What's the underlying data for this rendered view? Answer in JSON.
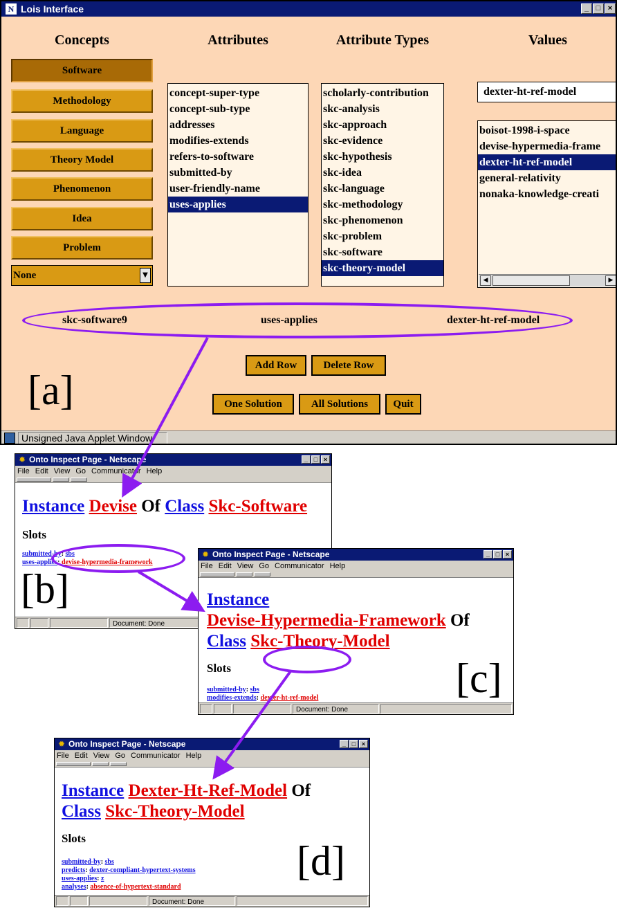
{
  "applet": {
    "title": "Lois Interface",
    "logo": "N",
    "window_buttons": [
      "minimize-icon",
      "maximize-icon",
      "close-icon"
    ],
    "headers": {
      "concepts": "Concepts",
      "attributes": "Attributes",
      "attribute_types": "Attribute Types",
      "values": "Values"
    },
    "concepts": [
      "Software",
      "Methodology",
      "Language",
      "Theory Model",
      "Phenomenon",
      "Idea",
      "Problem"
    ],
    "selected_concept": "Software",
    "dropdown_value": "None",
    "attributes": [
      "concept-super-type",
      "concept-sub-type",
      "addresses",
      "modifies-extends",
      "refers-to-software",
      "submitted-by",
      "user-friendly-name",
      "uses-applies"
    ],
    "selected_attribute": "uses-applies",
    "attribute_types": [
      "scholarly-contribution",
      "skc-analysis",
      "skc-approach",
      "skc-evidence",
      "skc-hypothesis",
      "skc-idea",
      "skc-language",
      "skc-methodology",
      "skc-phenomenon",
      "skc-problem",
      "skc-software",
      "skc-theory-model"
    ],
    "selected_attribute_type": "skc-theory-model",
    "value_input": "dexter-ht-ref-model",
    "values": [
      "boisot-1998-i-space",
      "devise-hypermedia-frame",
      "dexter-ht-ref-model",
      "general-relativity",
      "nonaka-knowledge-creati"
    ],
    "selected_value": "dexter-ht-ref-model",
    "query_row": {
      "concept": "skc-software9",
      "attribute": "uses-applies",
      "value": "dexter-ht-ref-model"
    },
    "buttons": {
      "add_row": "Add Row",
      "delete_row": "Delete Row",
      "one_solution": "One Solution",
      "all_solutions": "All Solutions",
      "quit": "Quit"
    },
    "panel_label": "[a]",
    "status_text": "Unsigned Java Applet Window"
  },
  "netscape": {
    "title": "Onto Inspect Page - Netscape",
    "menu": [
      "File",
      "Edit",
      "View",
      "Go",
      "Communicator",
      "Help"
    ],
    "status": "Document: Done"
  },
  "page_b": {
    "label": "[b]",
    "h_instance": "Instance",
    "h_name": "Devise",
    "h_of": "Of",
    "h_class": "Class",
    "h_classname": "Skc-Software",
    "slots": "Slots",
    "slot1_key": "submitted-by",
    "slot1_val": "sbs",
    "slot2_key": "uses-applies",
    "slot2_val": "devise-hypermedia-framework"
  },
  "page_c": {
    "label": "[c]",
    "h_instance": "Instance",
    "h_name": "Devise-Hypermedia-Framework",
    "h_of": "Of",
    "h_class": "Class",
    "h_classname": "Skc-Theory-Model",
    "slots": "Slots",
    "slot1_key": "submitted-by",
    "slot1_val": "sbs",
    "slot2_key": "modifies-extends",
    "slot2_val": "dexter-ht-ref-model"
  },
  "page_d": {
    "label": "[d]",
    "h_instance": "Instance",
    "h_name": "Dexter-Ht-Ref-Model",
    "h_of": "Of",
    "h_class": "Class",
    "h_classname": "Skc-Theory-Model",
    "slots": "Slots",
    "slot1_key": "submitted-by",
    "slot1_val": "sbs",
    "slot2_key": "predicts",
    "slot2_val": "dexter-compliant-hypertext-systems",
    "slot3_key": "uses-applies",
    "slot3_val": "z",
    "slot4_key": "analyses",
    "slot4_val": "absence-of-hypertext-standard"
  },
  "colors": {
    "highlight": "#8c1cf0",
    "title_bar": "#0a1a74",
    "button": "#d99a14",
    "applet_bg": "#fdd7b6",
    "link_blue": "#1010e0",
    "link_red": "#e00000"
  }
}
